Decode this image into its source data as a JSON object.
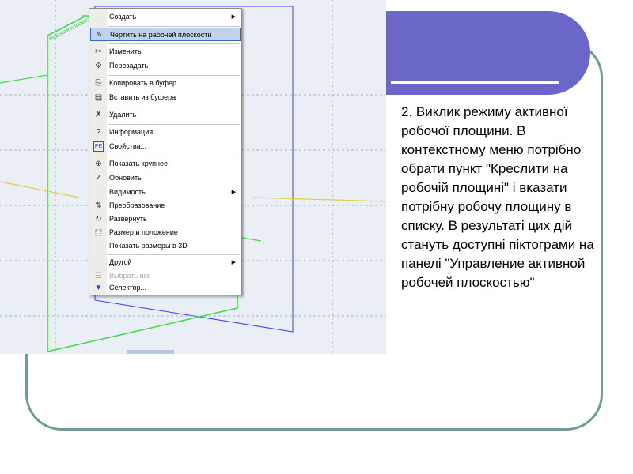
{
  "menu": {
    "items": [
      {
        "label": "Создать",
        "icon": "none",
        "submenu": true
      },
      {
        "label": "Чертить на рабочей плоскости",
        "icon": "sketch-pencil-icon",
        "selected": true
      },
      {
        "label": "Изменить",
        "icon": "edit-icon"
      },
      {
        "label": "Перезадать",
        "icon": "redefine-icon"
      },
      {
        "label": "Копировать в буфер",
        "icon": "copy-icon"
      },
      {
        "label": "Вставить из буфера",
        "icon": "paste-icon"
      },
      {
        "label": "Удалить",
        "icon": "delete-icon"
      },
      {
        "label": "Информация...",
        "icon": "question-icon"
      },
      {
        "label": "Свойства...",
        "icon": "properties-icon"
      },
      {
        "label": "Показать крупнее",
        "icon": "zoom-icon"
      },
      {
        "label": "Обновить",
        "icon": "refresh-icon"
      },
      {
        "label": "Видимость",
        "icon": "none",
        "submenu": true
      },
      {
        "label": "Преобразование",
        "icon": "transform-icon"
      },
      {
        "label": "Развернуть",
        "icon": "rotate-icon"
      },
      {
        "label": "Размер и положение",
        "icon": "size-position-icon"
      },
      {
        "label": "Показать размеры в 3D",
        "icon": "none"
      },
      {
        "label": "Другой",
        "icon": "none",
        "submenu": true
      },
      {
        "label": "Выбрать все",
        "icon": "select-all-icon",
        "disabled": true
      },
      {
        "label": "Селектор...",
        "icon": "selector-icon"
      }
    ]
  },
  "plane_label": "Рабочая плоскость",
  "description": "2. Виклик режиму активної робочої площини. В контекстному меню потрібно обрати пункт \"Креслити на робочій площині\" і вказати потрібну робочу площину в списку. В результаті цих дій стануть доступні піктограми на панелі \"Управление активной робочей плоскостью\"",
  "colors": {
    "accent": "#6a67c8",
    "frame": "#6e9a98",
    "selection": "#c1d2ee"
  }
}
